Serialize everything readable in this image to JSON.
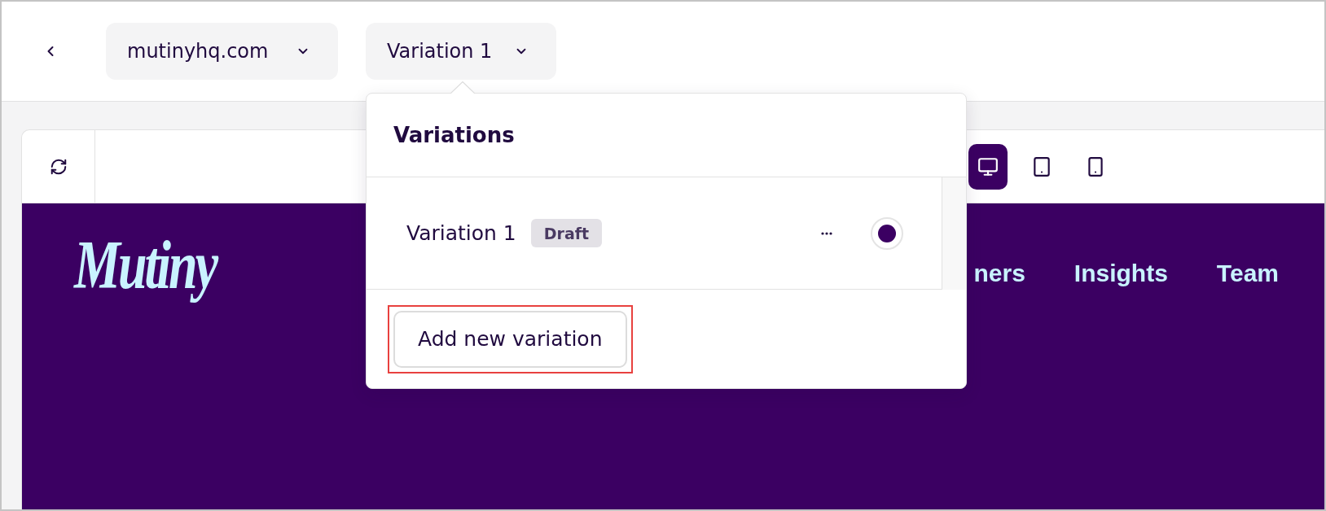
{
  "top_bar": {
    "site_selector": {
      "label": "mutinyhq.com"
    },
    "variation_selector": {
      "label": "Variation 1",
      "open": true
    }
  },
  "preview": {
    "devices": [
      {
        "kind": "desktop",
        "selected": true
      },
      {
        "kind": "tablet",
        "selected": false
      },
      {
        "kind": "phone",
        "selected": false
      }
    ],
    "site": {
      "logo": "Mutiny",
      "nav_items": [
        "ners",
        "Insights",
        "Team"
      ]
    }
  },
  "variations_popover": {
    "title": "Variations",
    "items": [
      {
        "name": "Variation 1",
        "status": "Draft",
        "selected": true
      }
    ],
    "add_button": {
      "label": "Add new variation",
      "highlighted": true
    }
  }
}
